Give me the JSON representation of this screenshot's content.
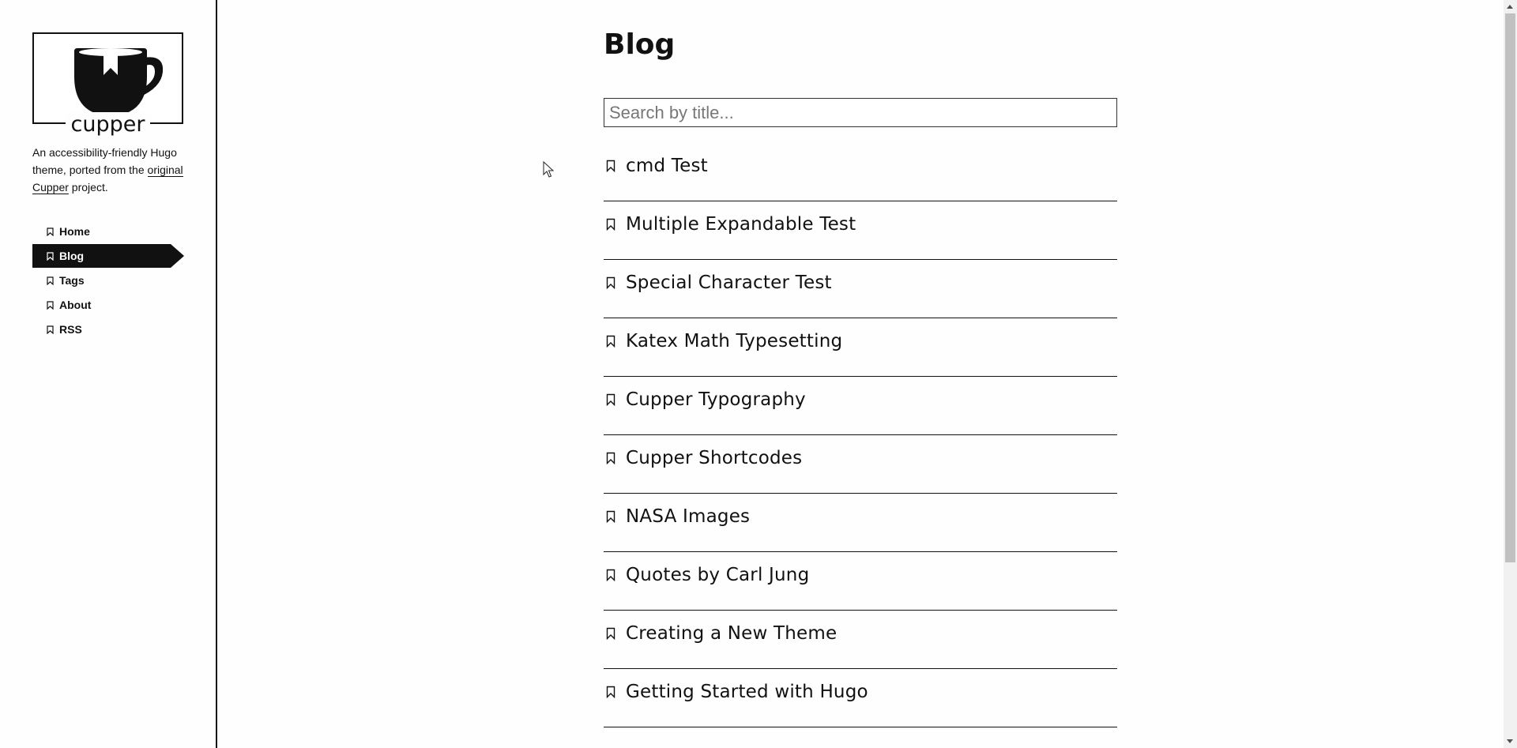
{
  "brand": {
    "name": "cupper"
  },
  "sidebar": {
    "tagline_pre": "An accessibility-friendly Hugo theme, ported from the ",
    "tagline_link": "original Cupper",
    "tagline_post": " project.",
    "nav": [
      {
        "label": "Home",
        "active": false
      },
      {
        "label": "Blog",
        "active": true
      },
      {
        "label": "Tags",
        "active": false
      },
      {
        "label": "About",
        "active": false
      },
      {
        "label": "RSS",
        "active": false
      }
    ]
  },
  "main": {
    "title": "Blog",
    "search": {
      "placeholder": "Search by title...",
      "value": ""
    },
    "posts": [
      {
        "title": "cmd Test"
      },
      {
        "title": "Multiple Expandable Test"
      },
      {
        "title": "Special Character Test"
      },
      {
        "title": "Katex Math Typesetting"
      },
      {
        "title": "Cupper Typography"
      },
      {
        "title": "Cupper Shortcodes"
      },
      {
        "title": "NASA Images"
      },
      {
        "title": "Quotes by Carl Jung"
      },
      {
        "title": "Creating a New Theme"
      },
      {
        "title": "Getting Started with Hugo"
      }
    ]
  },
  "icons": {
    "nav": "bookmark-icon",
    "post": "bookmark-icon",
    "logo": "cup-icon"
  },
  "colors": {
    "text": "#111111",
    "background": "#fefefe",
    "active_nav_bg": "#111111",
    "active_nav_text": "#ffffff"
  }
}
